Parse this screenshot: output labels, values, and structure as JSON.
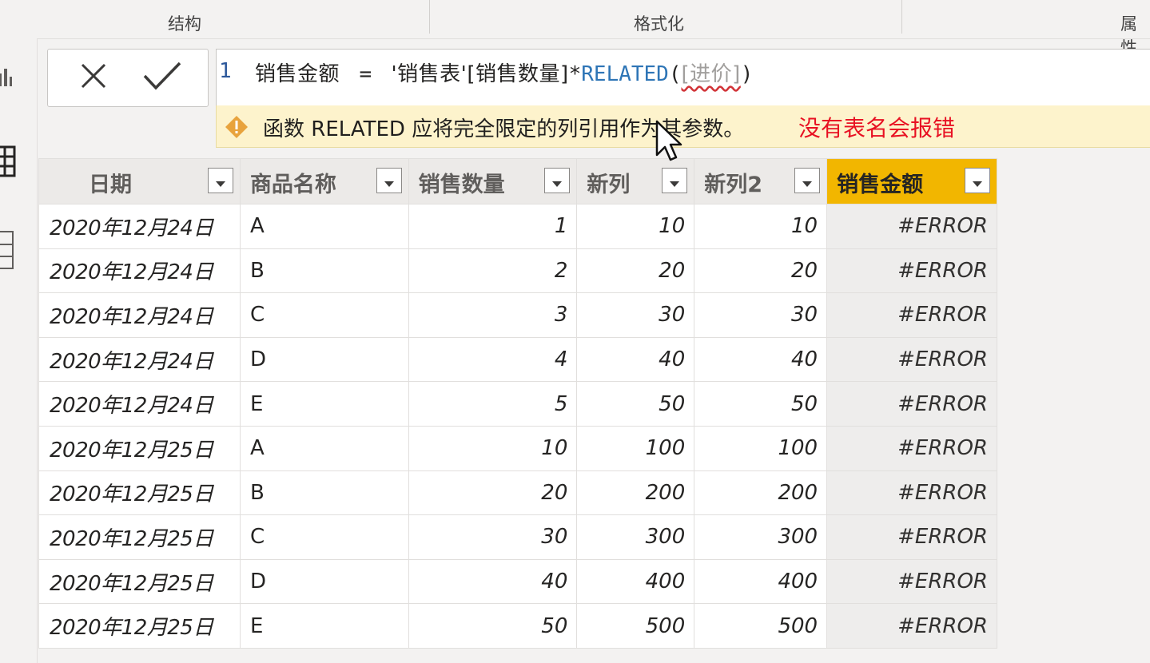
{
  "ribbon": {
    "groups": [
      "结构",
      "格式化",
      "属性"
    ]
  },
  "formula_bar": {
    "cancel_icon": "close-icon",
    "commit_icon": "checkmark-icon",
    "line_number": "1",
    "measure_name": "销售金额",
    "equals": "=",
    "table_ref": "'销售表'",
    "column_ref": "[销售数量]",
    "operator": "*",
    "function": "RELATED",
    "open_paren": "(",
    "arg": "[进价]",
    "close_paren": ")"
  },
  "warning": {
    "icon": "warning-icon",
    "message": "函数 RELATED 应将完全限定的列引用作为其参数。",
    "annotation": "没有表名会报错",
    "annotation_color": "#e81123"
  },
  "table": {
    "columns": [
      "日期",
      "商品名称",
      "销售数量",
      "新列",
      "新列2",
      "销售金额"
    ],
    "active_column": "销售金额",
    "active_color": "#f2b600",
    "rows": [
      [
        "2020年12月24日",
        "A",
        "1",
        "10",
        "10",
        "#ERROR"
      ],
      [
        "2020年12月24日",
        "B",
        "2",
        "20",
        "20",
        "#ERROR"
      ],
      [
        "2020年12月24日",
        "C",
        "3",
        "30",
        "30",
        "#ERROR"
      ],
      [
        "2020年12月24日",
        "D",
        "4",
        "40",
        "40",
        "#ERROR"
      ],
      [
        "2020年12月24日",
        "E",
        "5",
        "50",
        "50",
        "#ERROR"
      ],
      [
        "2020年12月25日",
        "A",
        "10",
        "100",
        "100",
        "#ERROR"
      ],
      [
        "2020年12月25日",
        "B",
        "20",
        "200",
        "200",
        "#ERROR"
      ],
      [
        "2020年12月25日",
        "C",
        "30",
        "300",
        "300",
        "#ERROR"
      ],
      [
        "2020年12月25日",
        "D",
        "40",
        "400",
        "400",
        "#ERROR"
      ],
      [
        "2020年12月25日",
        "E",
        "50",
        "500",
        "500",
        "#ERROR"
      ]
    ]
  }
}
